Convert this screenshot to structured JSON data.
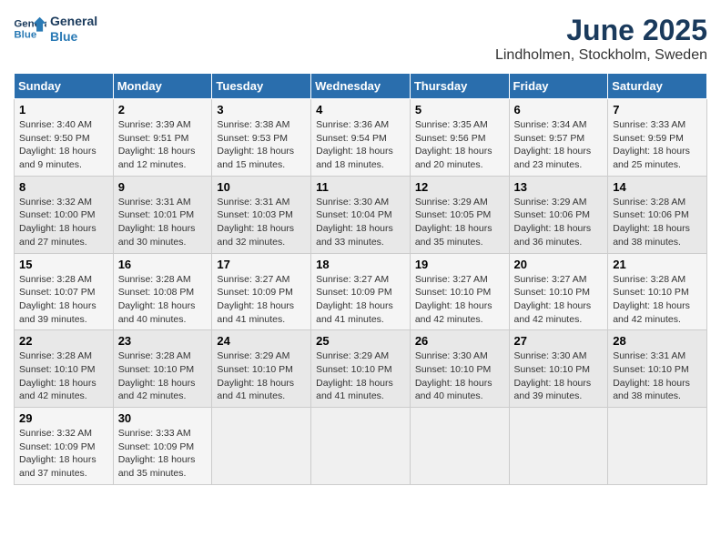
{
  "header": {
    "logo_line1": "General",
    "logo_line2": "Blue",
    "month_year": "June 2025",
    "location": "Lindholmen, Stockholm, Sweden"
  },
  "days_of_week": [
    "Sunday",
    "Monday",
    "Tuesday",
    "Wednesday",
    "Thursday",
    "Friday",
    "Saturday"
  ],
  "weeks": [
    [
      {
        "day": "1",
        "sunrise": "3:40 AM",
        "sunset": "9:50 PM",
        "daylight": "18 hours and 9 minutes."
      },
      {
        "day": "2",
        "sunrise": "3:39 AM",
        "sunset": "9:51 PM",
        "daylight": "18 hours and 12 minutes."
      },
      {
        "day": "3",
        "sunrise": "3:38 AM",
        "sunset": "9:53 PM",
        "daylight": "18 hours and 15 minutes."
      },
      {
        "day": "4",
        "sunrise": "3:36 AM",
        "sunset": "9:54 PM",
        "daylight": "18 hours and 18 minutes."
      },
      {
        "day": "5",
        "sunrise": "3:35 AM",
        "sunset": "9:56 PM",
        "daylight": "18 hours and 20 minutes."
      },
      {
        "day": "6",
        "sunrise": "3:34 AM",
        "sunset": "9:57 PM",
        "daylight": "18 hours and 23 minutes."
      },
      {
        "day": "7",
        "sunrise": "3:33 AM",
        "sunset": "9:59 PM",
        "daylight": "18 hours and 25 minutes."
      }
    ],
    [
      {
        "day": "8",
        "sunrise": "3:32 AM",
        "sunset": "10:00 PM",
        "daylight": "18 hours and 27 minutes."
      },
      {
        "day": "9",
        "sunrise": "3:31 AM",
        "sunset": "10:01 PM",
        "daylight": "18 hours and 30 minutes."
      },
      {
        "day": "10",
        "sunrise": "3:31 AM",
        "sunset": "10:03 PM",
        "daylight": "18 hours and 32 minutes."
      },
      {
        "day": "11",
        "sunrise": "3:30 AM",
        "sunset": "10:04 PM",
        "daylight": "18 hours and 33 minutes."
      },
      {
        "day": "12",
        "sunrise": "3:29 AM",
        "sunset": "10:05 PM",
        "daylight": "18 hours and 35 minutes."
      },
      {
        "day": "13",
        "sunrise": "3:29 AM",
        "sunset": "10:06 PM",
        "daylight": "18 hours and 36 minutes."
      },
      {
        "day": "14",
        "sunrise": "3:28 AM",
        "sunset": "10:06 PM",
        "daylight": "18 hours and 38 minutes."
      }
    ],
    [
      {
        "day": "15",
        "sunrise": "3:28 AM",
        "sunset": "10:07 PM",
        "daylight": "18 hours and 39 minutes."
      },
      {
        "day": "16",
        "sunrise": "3:28 AM",
        "sunset": "10:08 PM",
        "daylight": "18 hours and 40 minutes."
      },
      {
        "day": "17",
        "sunrise": "3:27 AM",
        "sunset": "10:09 PM",
        "daylight": "18 hours and 41 minutes."
      },
      {
        "day": "18",
        "sunrise": "3:27 AM",
        "sunset": "10:09 PM",
        "daylight": "18 hours and 41 minutes."
      },
      {
        "day": "19",
        "sunrise": "3:27 AM",
        "sunset": "10:10 PM",
        "daylight": "18 hours and 42 minutes."
      },
      {
        "day": "20",
        "sunrise": "3:27 AM",
        "sunset": "10:10 PM",
        "daylight": "18 hours and 42 minutes."
      },
      {
        "day": "21",
        "sunrise": "3:28 AM",
        "sunset": "10:10 PM",
        "daylight": "18 hours and 42 minutes."
      }
    ],
    [
      {
        "day": "22",
        "sunrise": "3:28 AM",
        "sunset": "10:10 PM",
        "daylight": "18 hours and 42 minutes."
      },
      {
        "day": "23",
        "sunrise": "3:28 AM",
        "sunset": "10:10 PM",
        "daylight": "18 hours and 42 minutes."
      },
      {
        "day": "24",
        "sunrise": "3:29 AM",
        "sunset": "10:10 PM",
        "daylight": "18 hours and 41 minutes."
      },
      {
        "day": "25",
        "sunrise": "3:29 AM",
        "sunset": "10:10 PM",
        "daylight": "18 hours and 41 minutes."
      },
      {
        "day": "26",
        "sunrise": "3:30 AM",
        "sunset": "10:10 PM",
        "daylight": "18 hours and 40 minutes."
      },
      {
        "day": "27",
        "sunrise": "3:30 AM",
        "sunset": "10:10 PM",
        "daylight": "18 hours and 39 minutes."
      },
      {
        "day": "28",
        "sunrise": "3:31 AM",
        "sunset": "10:10 PM",
        "daylight": "18 hours and 38 minutes."
      }
    ],
    [
      {
        "day": "29",
        "sunrise": "3:32 AM",
        "sunset": "10:09 PM",
        "daylight": "18 hours and 37 minutes."
      },
      {
        "day": "30",
        "sunrise": "3:33 AM",
        "sunset": "10:09 PM",
        "daylight": "18 hours and 35 minutes."
      },
      null,
      null,
      null,
      null,
      null
    ]
  ],
  "labels": {
    "sunrise": "Sunrise:",
    "sunset": "Sunset:",
    "daylight": "Daylight:"
  }
}
